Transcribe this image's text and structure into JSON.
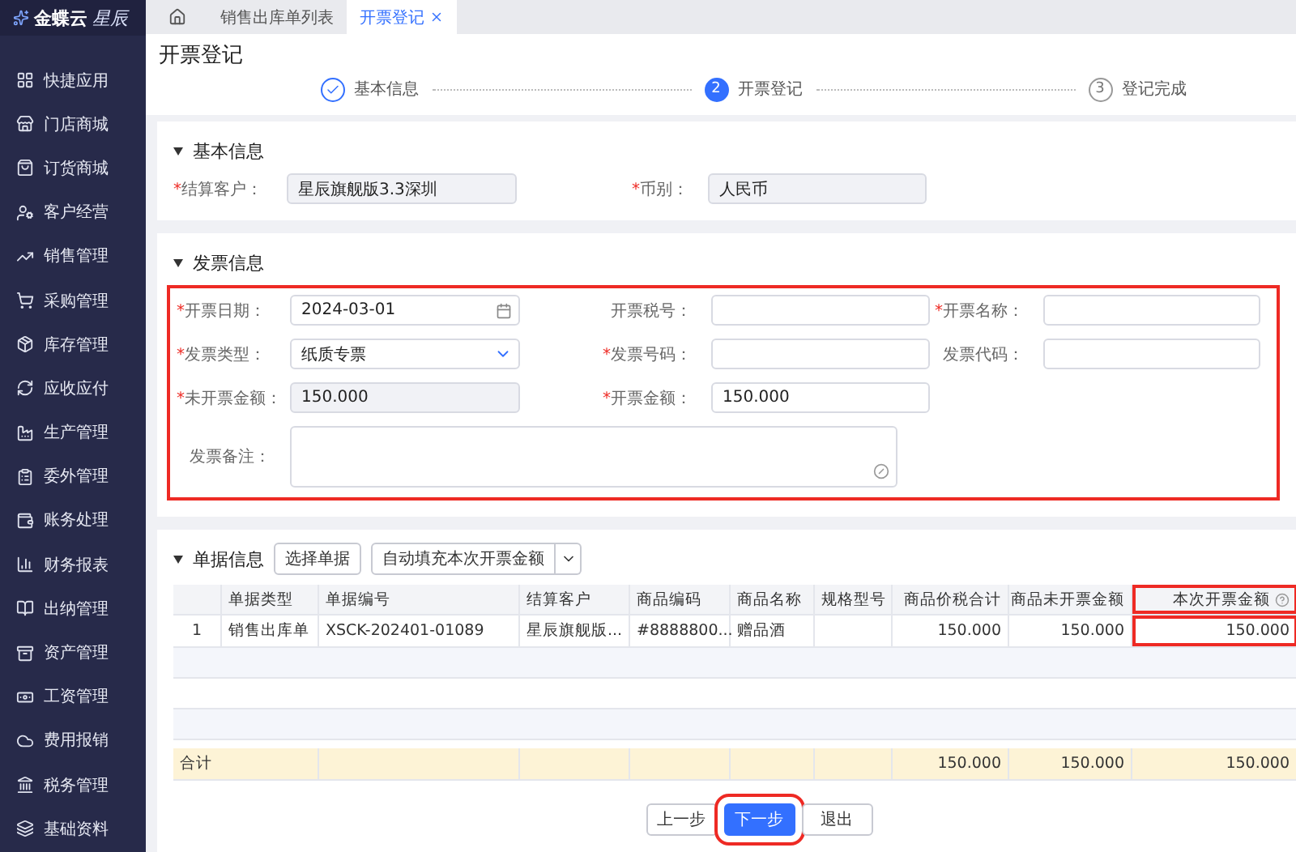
{
  "app": {
    "logo": "金蝶云",
    "logo_sub": "星辰"
  },
  "sidebar": {
    "items": [
      {
        "label": "快捷应用"
      },
      {
        "label": "门店商城"
      },
      {
        "label": "订货商城"
      },
      {
        "label": "客户经营"
      },
      {
        "label": "销售管理"
      },
      {
        "label": "采购管理"
      },
      {
        "label": "库存管理"
      },
      {
        "label": "应收应付"
      },
      {
        "label": "生产管理"
      },
      {
        "label": "委外管理"
      },
      {
        "label": "账务处理"
      },
      {
        "label": "财务报表"
      },
      {
        "label": "出纳管理"
      },
      {
        "label": "资产管理"
      },
      {
        "label": "工资管理"
      },
      {
        "label": "费用报销"
      },
      {
        "label": "税务管理"
      },
      {
        "label": "基础资料"
      }
    ]
  },
  "tabs": [
    {
      "label": "销售出库单列表",
      "selected": false,
      "closable": false
    },
    {
      "label": "开票登记",
      "selected": true,
      "closable": true
    }
  ],
  "page": {
    "title": "开票登记"
  },
  "steps": [
    {
      "label": "基本信息",
      "completed": true,
      "selected": false
    },
    {
      "number": "2",
      "label": "开票登记",
      "completed": false,
      "selected": true
    },
    {
      "number": "3",
      "label": "登记完成",
      "completed": false,
      "selected": false
    }
  ],
  "basic_info": {
    "title": "基本信息",
    "expanded": true,
    "highlighted": false,
    "fields": [
      {
        "marker": "*",
        "label": "结算客户：",
        "kind": "readonly",
        "value": "星辰旗舰版3.3深圳"
      },
      {
        "marker": "*",
        "label": "币别：",
        "kind": "readonly",
        "value": "人民币"
      }
    ]
  },
  "invoice_info": {
    "title": "发票信息",
    "expanded": true,
    "highlighted": true,
    "fields": [
      {
        "marker": "*",
        "label": "开票日期：",
        "kind": "date",
        "value": "2024-03-01"
      },
      {
        "label": "开票税号：",
        "kind": "text"
      },
      {
        "marker": "*",
        "label": "开票名称：",
        "kind": "text"
      },
      {
        "marker": "*",
        "label": "发票类型：",
        "kind": "select",
        "value": "纸质专票"
      },
      {
        "marker": "*",
        "label": "发票号码：",
        "kind": "text"
      },
      {
        "label": "发票代码：",
        "kind": "text"
      },
      {
        "marker": "*",
        "label": "未开票金额：",
        "kind": "readonly",
        "value": "150.000"
      },
      {
        "marker": "*",
        "label": "开票金额：",
        "kind": "text",
        "value": "150.000"
      },
      {
        "label": "发票备注：",
        "kind": "textarea"
      }
    ]
  },
  "documents": {
    "title": "单据信息",
    "expanded": true,
    "buttons": [
      {
        "label": "选择单据",
        "kind": "plain"
      },
      {
        "label": "自动填充本次开票金额",
        "kind": "split"
      }
    ],
    "table": {
      "columns": [
        {
          "label": "单据类型",
          "kind": "text",
          "help": false,
          "highlighted": false
        },
        {
          "label": "单据编号",
          "kind": "text",
          "help": false,
          "highlighted": false
        },
        {
          "label": "结算客户",
          "kind": "text",
          "help": false,
          "highlighted": false
        },
        {
          "label": "商品编码",
          "kind": "text",
          "help": false,
          "highlighted": false
        },
        {
          "label": "商品名称",
          "kind": "text",
          "help": false,
          "highlighted": false
        },
        {
          "label": "规格型号",
          "kind": "text",
          "help": false,
          "highlighted": false
        },
        {
          "label": "商品价税合计",
          "kind": "number",
          "help": false,
          "highlighted": false
        },
        {
          "label": "商品未开票金额",
          "kind": "number",
          "help": false,
          "highlighted": false
        },
        {
          "label": "本次开票金额",
          "kind": "number",
          "help": true,
          "highlighted": true
        }
      ],
      "rows": [
        {
          "index": "1",
          "cells": [
            "销售出库单",
            "XSCK-202401-01089",
            "星辰旗舰版...",
            "#8888800...",
            "赠品酒",
            null,
            "150.000",
            "150.000",
            "150.000"
          ]
        }
      ],
      "totals": {
        "label": "合计",
        "cells": [
          null,
          null,
          null,
          null,
          null,
          null,
          "150.000",
          "150.000",
          "150.000"
        ]
      }
    }
  },
  "footer_buttons": [
    {
      "label": "上一步",
      "kind": "default",
      "highlighted": false
    },
    {
      "label": "下一步",
      "kind": "primary",
      "highlighted": true
    },
    {
      "label": "退出",
      "kind": "default",
      "highlighted": false
    }
  ]
}
